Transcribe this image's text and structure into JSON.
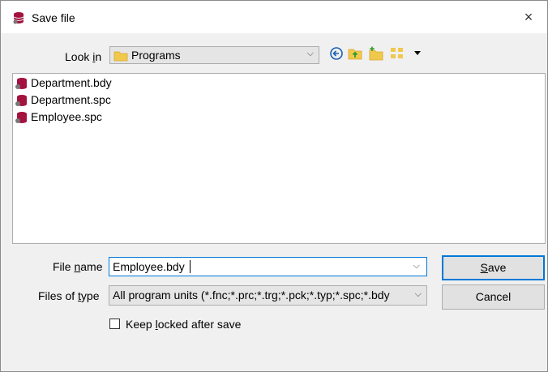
{
  "window": {
    "title": "Save file",
    "close_glyph": "×",
    "title_icon": "database-icon"
  },
  "look_in": {
    "label_pre": "Look ",
    "label_accel": "i",
    "label_post": "n",
    "value": "Programs",
    "folder_icon": "folder-icon",
    "arrow": "⌵"
  },
  "toolbar": {
    "icons": [
      "back-icon",
      "up-folder-icon",
      "new-folder-icon",
      "view-menu-icon",
      "chevron-down-icon"
    ]
  },
  "files": [
    {
      "name": "Department.bdy",
      "icon": "database-icon"
    },
    {
      "name": "Department.spc",
      "icon": "database-icon"
    },
    {
      "name": "Employee.spc",
      "icon": "database-icon"
    }
  ],
  "file_name": {
    "label_pre": "File ",
    "label_accel": "n",
    "label_post": "ame",
    "value": "Employee.bdy",
    "arrow": "⌵"
  },
  "files_of_type": {
    "label_pre": "Files of ",
    "label_accel": "t",
    "label_post": "ype",
    "value": "All program units (*.fnc;*.prc;*.trg;*.pck;*.typ;*.spc;*.bdy",
    "arrow": "⌵"
  },
  "buttons": {
    "save_accel": "S",
    "save_rest": "ave",
    "cancel": "Cancel"
  },
  "keep_locked": {
    "pre": "Keep ",
    "accel": "l",
    "post": "ocked after save",
    "checked": false
  },
  "colors": {
    "db_icon": "#a4123f",
    "accent": "#0078d7",
    "folder": "#f0c94c"
  }
}
